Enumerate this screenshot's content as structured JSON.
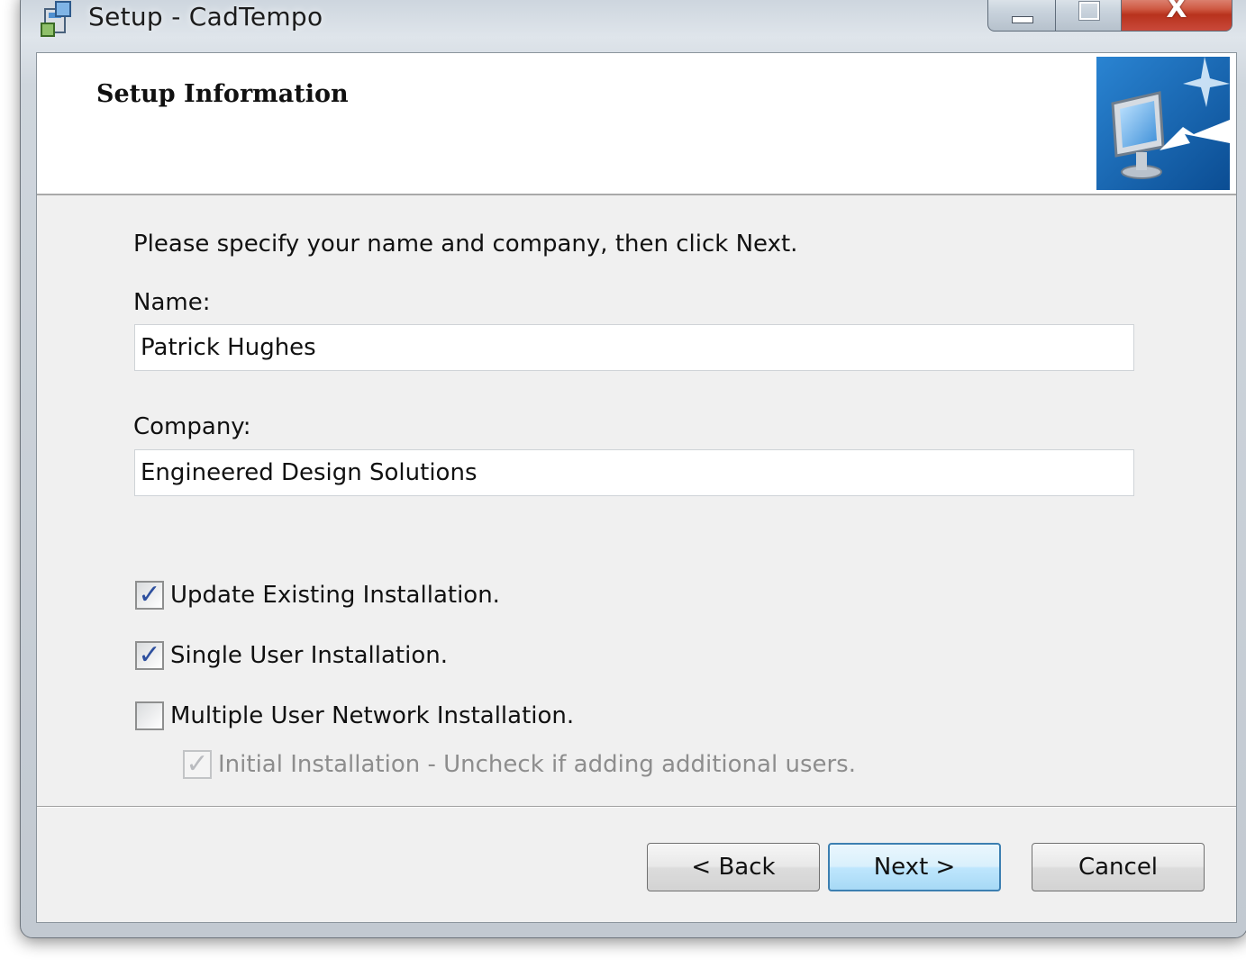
{
  "window": {
    "title": "Setup - CadTempo",
    "close_glyph": "X",
    "icons": {
      "app": "setup-app-icon",
      "minimize": "minimize-icon",
      "maximize": "maximize-icon",
      "close": "close-icon"
    }
  },
  "header": {
    "title": "Setup Information",
    "image": "computer-monitor-arrow-icon"
  },
  "form": {
    "prompt": "Please specify your name and company, then click Next.",
    "name": {
      "label": "Name:",
      "value": "Patrick Hughes"
    },
    "company": {
      "label": "Company:",
      "value": "Engineered Design Solutions"
    },
    "checkboxes": [
      {
        "label": "Update Existing Installation.",
        "checked": true,
        "enabled": true
      },
      {
        "label": "Single User Installation.",
        "checked": true,
        "enabled": true
      },
      {
        "label": "Multiple User Network Installation.",
        "checked": false,
        "enabled": true
      },
      {
        "label": "Initial Installation - Uncheck if adding additional users.",
        "checked": true,
        "enabled": false
      }
    ]
  },
  "buttons": {
    "back": "< Back",
    "next": "Next >",
    "cancel": "Cancel"
  }
}
